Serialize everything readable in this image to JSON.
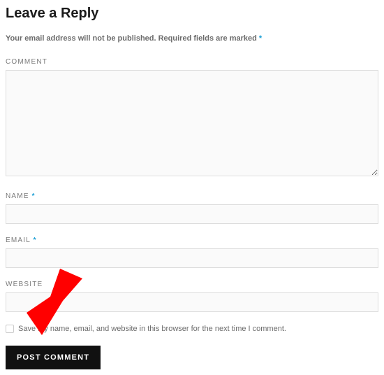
{
  "heading": "Leave a Reply",
  "notice": {
    "text_before": "Your email address will not be published. Required fields are marked ",
    "marker": "*"
  },
  "fields": {
    "comment": {
      "label": "COMMENT"
    },
    "name": {
      "label": "NAME ",
      "required": "*"
    },
    "email": {
      "label": "EMAIL ",
      "required": "*"
    },
    "website": {
      "label": "WEBSITE"
    }
  },
  "consent": {
    "text": "Save my name, email, and website in this browser for the next time I comment."
  },
  "submit": {
    "label": "POST COMMENT"
  }
}
